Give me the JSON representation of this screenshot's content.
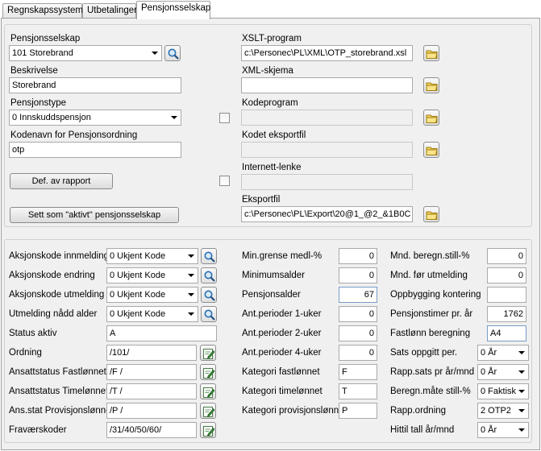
{
  "tabs": [
    "Regnskapssystem",
    "Utbetalinger",
    "Pensjonsselskap"
  ],
  "top": {
    "pensjonsselskap": {
      "label": "Pensjonsselskap",
      "value": "101 Storebrand"
    },
    "beskrivelse": {
      "label": "Beskrivelse",
      "value": "Storebrand"
    },
    "pensjonstype": {
      "label": "Pensjonstype",
      "value": "0 Innskuddspensjon"
    },
    "kodenavn": {
      "label": "Kodenavn for Pensjonsordning",
      "value": "otp"
    },
    "def_button": "Def. av rapport",
    "aktiv_button": "Sett som \"aktivt\" pensjonsselskap",
    "xslt": {
      "label": "XSLT-program",
      "value": "c:\\Personec\\PL\\XML\\OTP_storebrand.xsl"
    },
    "xml": {
      "label": "XML-skjema",
      "value": ""
    },
    "kodeprogram": {
      "label": "Kodeprogram",
      "value": ""
    },
    "kodet": {
      "label": "Kodet eksportfil",
      "value": ""
    },
    "internett": {
      "label": "Internett-lenke",
      "value": ""
    },
    "eksportfil": {
      "label": "Eksportfil",
      "value": "c:\\Personec\\PL\\Export\\20@1_@2_&1B0C"
    }
  },
  "left": [
    {
      "label": "Aksjonskode innmelding",
      "value": "0 Ukjent Kode",
      "kind": "combo"
    },
    {
      "label": "Aksjonskode endring",
      "value": "0 Ukjent Kode",
      "kind": "combo"
    },
    {
      "label": "Aksjonskode utmelding",
      "value": "0 Ukjent Kode",
      "kind": "combo"
    },
    {
      "label": "Utmelding nådd alder",
      "value": "0 Ukjent Kode",
      "kind": "combo"
    },
    {
      "label": "Status aktiv",
      "value": "A",
      "kind": "text"
    },
    {
      "label": "Ordning",
      "value": "/101/",
      "kind": "edit"
    },
    {
      "label": "Ansattstatus Fastlønnet",
      "value": "/F /",
      "kind": "edit"
    },
    {
      "label": "Ansattstatus Timelønnet",
      "value": "/T /",
      "kind": "edit"
    },
    {
      "label": "Ans.stat Provisjonslønne",
      "value": "/P /",
      "kind": "edit"
    },
    {
      "label": "Fraværskoder",
      "value": "/31/40/50/60/",
      "kind": "edit"
    }
  ],
  "middle": [
    {
      "label": "Min.grense medl-%",
      "value": "0",
      "align": "right"
    },
    {
      "label": "Minimumsalder",
      "value": "0",
      "align": "right"
    },
    {
      "label": "Pensjonsalder",
      "value": "67",
      "align": "right"
    },
    {
      "label": "Ant.perioder 1-uker",
      "value": "0",
      "align": "right"
    },
    {
      "label": "Ant.perioder 2-uker",
      "value": "0",
      "align": "right"
    },
    {
      "label": "Ant.perioder 4-uker",
      "value": "0",
      "align": "right"
    },
    {
      "label": "Kategori fastlønnet",
      "value": "F",
      "align": "left"
    },
    {
      "label": "Kategori timelønnet",
      "value": "T",
      "align": "left"
    },
    {
      "label": "Kategori provisjonslønne",
      "value": "P",
      "align": "left"
    }
  ],
  "right": [
    {
      "label": "Mnd. beregn.still-%",
      "value": "0",
      "kind": "num"
    },
    {
      "label": "Mnd. før utmelding",
      "value": "0",
      "kind": "num"
    },
    {
      "label": "Oppbygging kontering",
      "value": "",
      "kind": "text"
    },
    {
      "label": "Pensjonstimer pr. år",
      "value": "1762",
      "kind": "num"
    },
    {
      "label": "Fastlønn beregning",
      "value": "A4",
      "kind": "text"
    },
    {
      "label": "Sats oppgitt per.",
      "value": "0 År",
      "kind": "combo"
    },
    {
      "label": "Rapp.sats pr år/mnd",
      "value": "0 År",
      "kind": "combo"
    },
    {
      "label": "Beregn.måte still-%",
      "value": "0 Faktisk",
      "kind": "combo"
    },
    {
      "label": "Rapp.ordning",
      "value": "2 OTP2",
      "kind": "combo"
    },
    {
      "label": "Hittil tall år/mnd",
      "value": "0 År",
      "kind": "combo"
    }
  ]
}
